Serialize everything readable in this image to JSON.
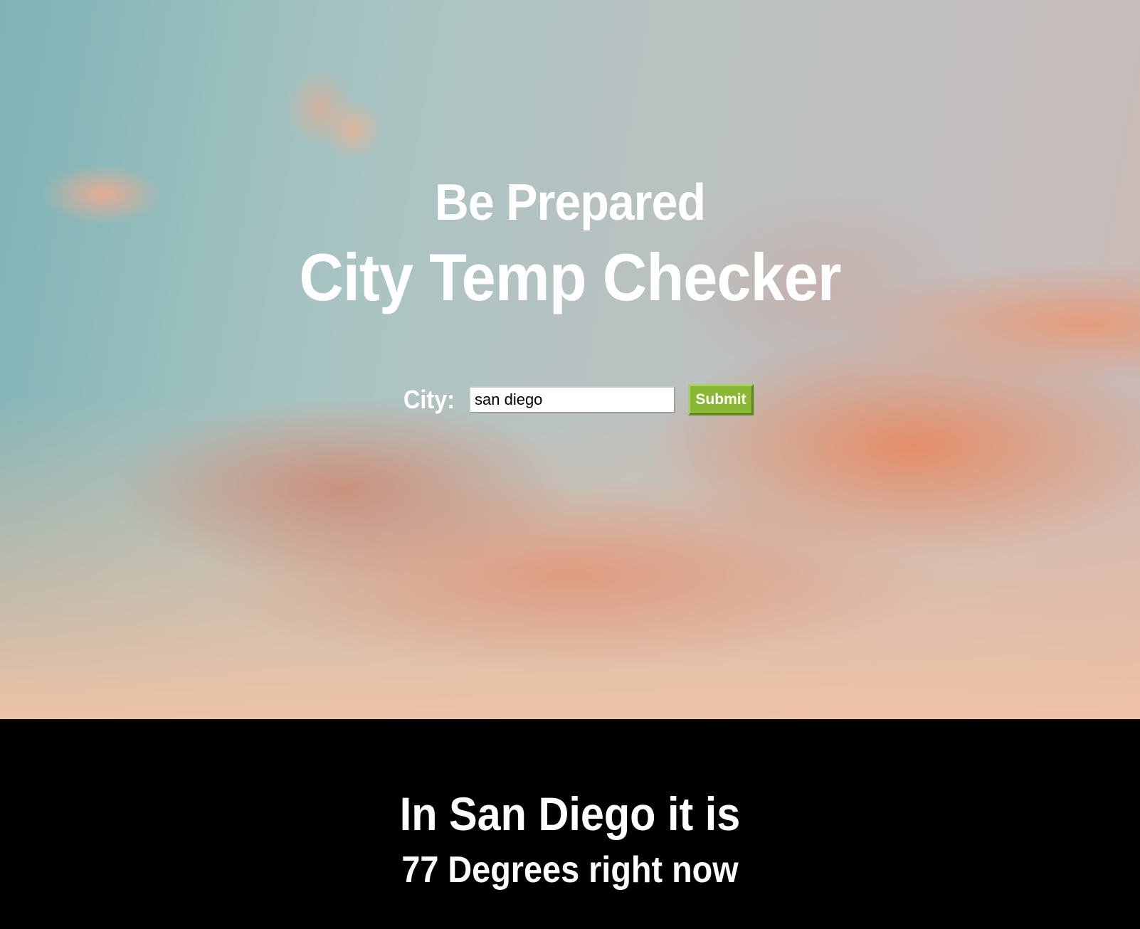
{
  "hero": {
    "kicker": "Be Prepared",
    "title": "City Temp Checker"
  },
  "form": {
    "city_label": "City:",
    "city_value": "san diego",
    "submit_label": "Submit"
  },
  "result": {
    "heading": "In San Diego it is",
    "temperature": "77 Degrees right now"
  },
  "colors": {
    "submit_green": "#8ab734",
    "result_background": "#000000",
    "text": "#ffffff"
  }
}
